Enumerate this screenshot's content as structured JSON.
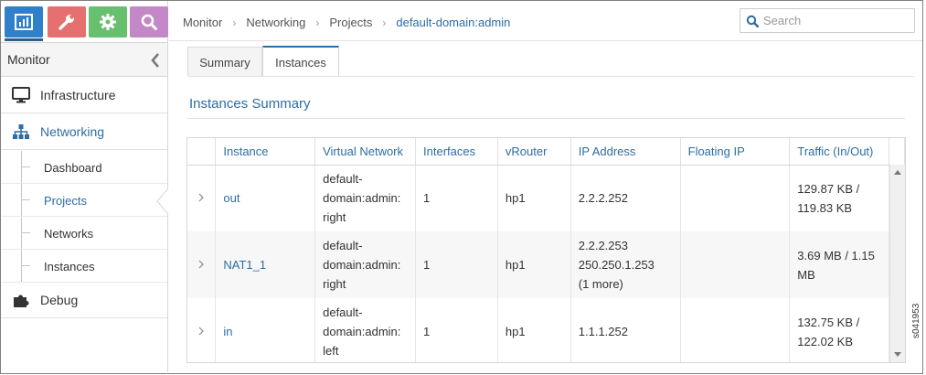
{
  "nav_tiles": [
    {
      "name": "monitor",
      "icon": "bar-chart-icon",
      "color": "#2f80c9"
    },
    {
      "name": "configure",
      "icon": "wrench-icon",
      "color": "#e66f6f"
    },
    {
      "name": "settings",
      "icon": "gear-icon",
      "color": "#67c06e"
    },
    {
      "name": "query",
      "icon": "search-icon",
      "color": "#c388c8"
    }
  ],
  "sidebar": {
    "header": "Monitor",
    "items": [
      {
        "label": "Infrastructure",
        "icon": "monitor-icon"
      },
      {
        "label": "Networking",
        "icon": "network-tree-icon",
        "active": true
      },
      {
        "label": "Debug",
        "icon": "puzzle-icon"
      }
    ],
    "sub_items": [
      "Dashboard",
      "Projects",
      "Networks",
      "Instances"
    ],
    "active_sub": "Projects"
  },
  "breadcrumb": [
    "Monitor",
    "Networking",
    "Projects",
    "default-domain:admin"
  ],
  "search": {
    "placeholder": "Search"
  },
  "tabs": [
    "Summary",
    "Instances"
  ],
  "active_tab": "Instances",
  "section_title": "Instances Summary",
  "table": {
    "columns": [
      "Instance",
      "Virtual Network",
      "Interfaces",
      "vRouter",
      "IP Address",
      "Floating IP",
      "Traffic (In/Out)"
    ],
    "rows": [
      {
        "instance": "out",
        "vn": [
          "default-",
          "domain:admin:",
          "right"
        ],
        "interfaces": "1",
        "vrouter": "hp1",
        "ip": [
          "2.2.2.252"
        ],
        "floating": "",
        "traffic": [
          "129.87 KB /",
          "119.83 KB"
        ]
      },
      {
        "instance": "NAT1_1",
        "vn": [
          "default-",
          "domain:admin:",
          "right"
        ],
        "interfaces": "1",
        "vrouter": "hp1",
        "ip": [
          "2.2.2.253",
          "250.250.1.253",
          "(1 more)"
        ],
        "floating": "",
        "traffic": [
          "3.69 MB / 1.15",
          "MB"
        ]
      },
      {
        "instance": "in",
        "vn": [
          "default-",
          "domain:admin:",
          "left"
        ],
        "interfaces": "1",
        "vrouter": "hp1",
        "ip": [
          "1.1.1.252"
        ],
        "floating": "",
        "traffic": [
          "132.75 KB /",
          "122.02 KB"
        ]
      }
    ]
  },
  "figure_id": "s041953",
  "colors": {
    "accent": "#2d6da3"
  }
}
